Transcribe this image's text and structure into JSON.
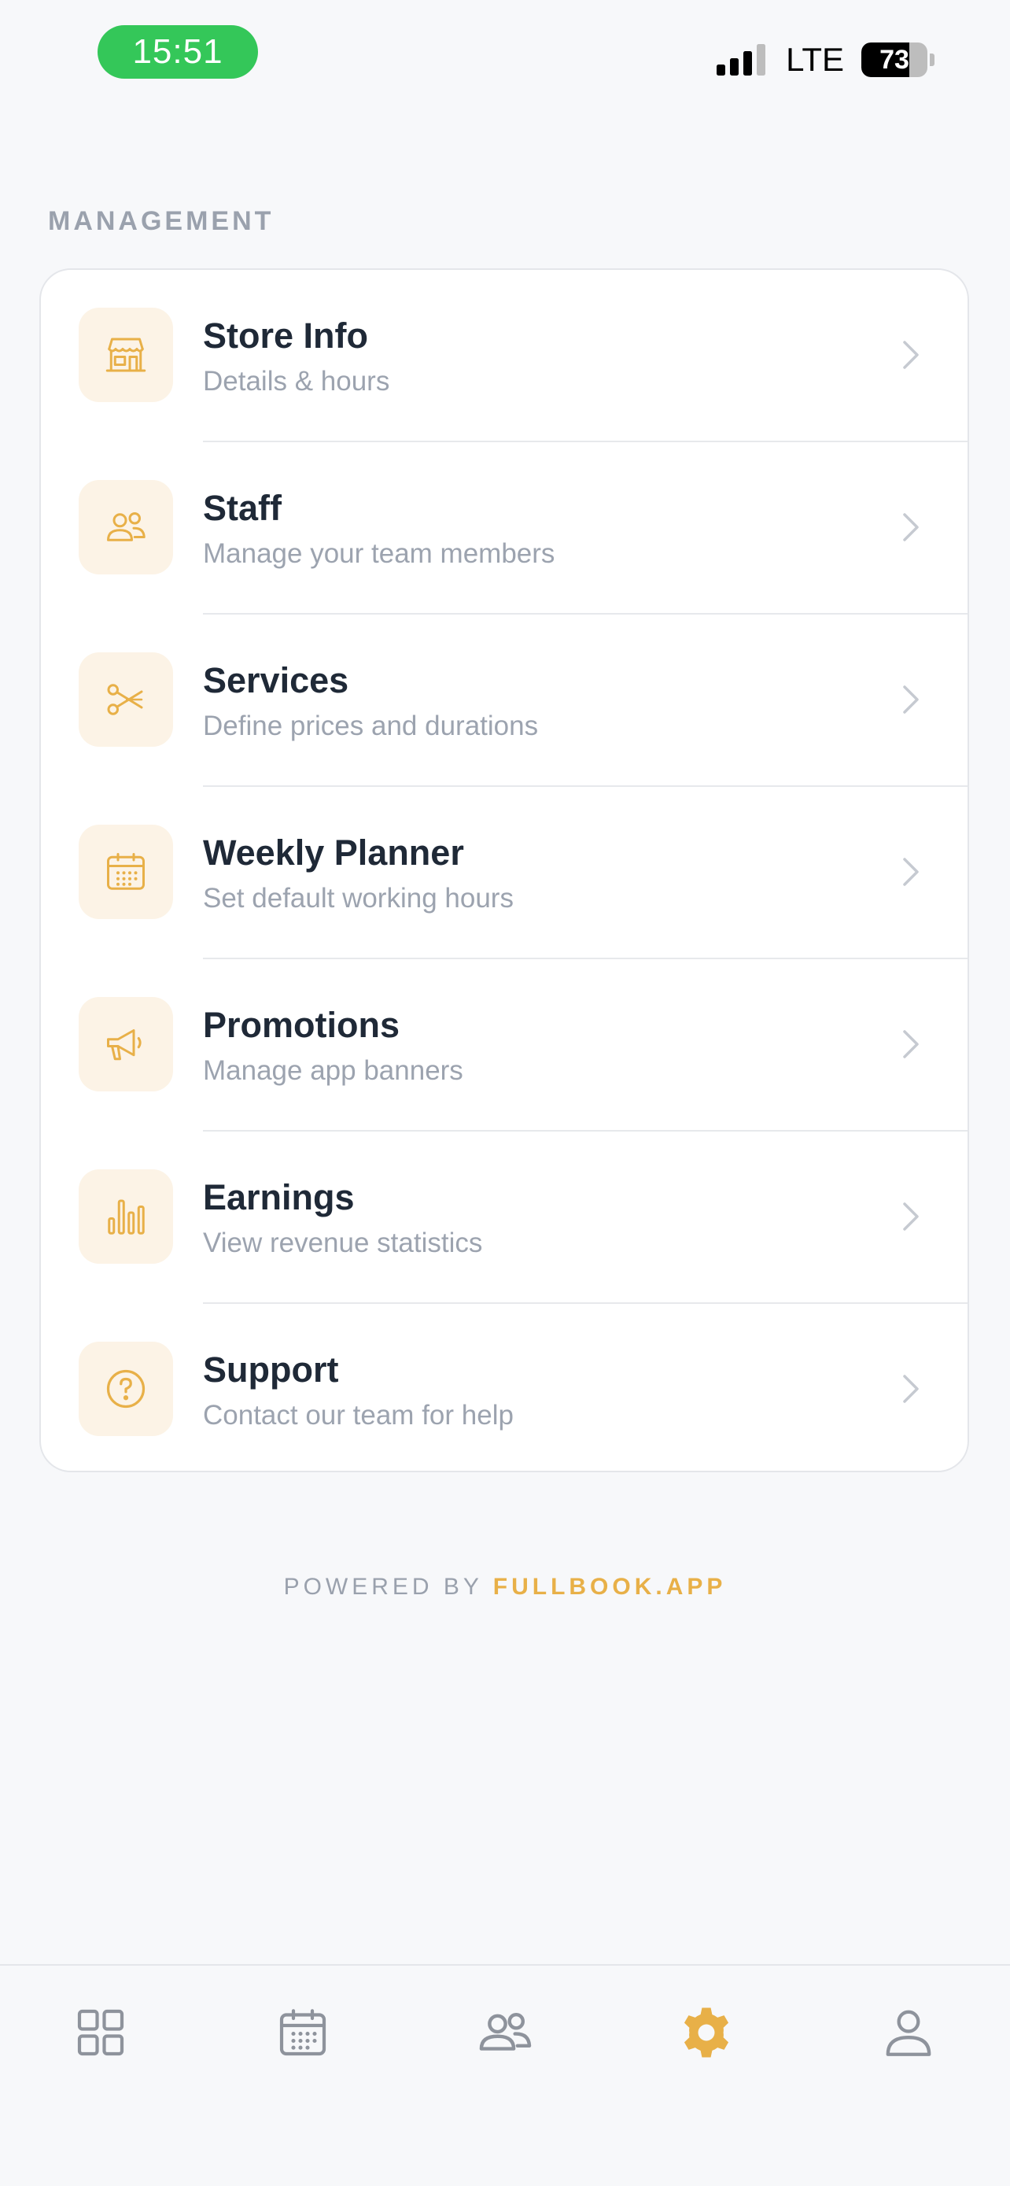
{
  "status_bar": {
    "time": "15:51",
    "network": "LTE",
    "battery_percent": 73,
    "battery_text": "73"
  },
  "section": {
    "title": "MANAGEMENT"
  },
  "menu": [
    {
      "title": "Store Info",
      "subtitle": "Details & hours",
      "icon": "store-icon"
    },
    {
      "title": "Staff",
      "subtitle": "Manage your team members",
      "icon": "team-icon"
    },
    {
      "title": "Services",
      "subtitle": "Define prices and durations",
      "icon": "scissors-icon"
    },
    {
      "title": "Weekly Planner",
      "subtitle": "Set default working hours",
      "icon": "calendar-icon"
    },
    {
      "title": "Promotions",
      "subtitle": "Manage app banners",
      "icon": "megaphone-icon"
    },
    {
      "title": "Earnings",
      "subtitle": "View revenue statistics",
      "icon": "bar-chart-icon"
    },
    {
      "title": "Support",
      "subtitle": "Contact our team for help",
      "icon": "help-circle-icon"
    }
  ],
  "footer": {
    "prefix": "POWERED BY ",
    "brand": "FULLBOOK.APP"
  },
  "tab_bar": {
    "items": [
      {
        "icon": "dashboard-grid-icon",
        "active": false
      },
      {
        "icon": "calendar-icon",
        "active": false
      },
      {
        "icon": "users-icon",
        "active": false
      },
      {
        "icon": "settings-gear-icon",
        "active": true
      },
      {
        "icon": "profile-icon",
        "active": false
      }
    ]
  },
  "colors": {
    "accent": "#E8B048",
    "icon_bg": "#FCF3E6",
    "background": "#F7F8FA",
    "status_pill": "#34C759",
    "title_text": "#1F2937",
    "subtitle_text": "#9CA3AF",
    "inactive_icon": "#8E939C"
  }
}
